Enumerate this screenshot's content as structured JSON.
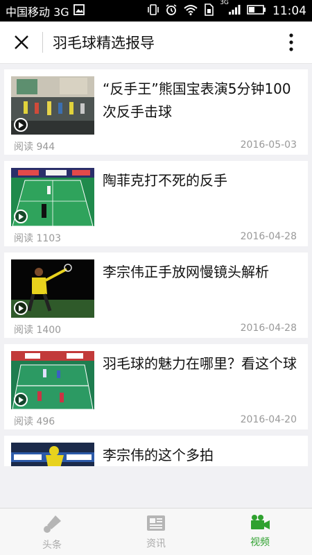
{
  "status_bar": {
    "carrier": "中国移动 3G",
    "network_small": "3G",
    "time": "11:04"
  },
  "header": {
    "title": "羽毛球精选报导",
    "close_icon": "close-icon",
    "more_icon": "more-vertical-icon"
  },
  "articles": [
    {
      "title": "“反手王”熊国宝表演5分钟100次反手击球",
      "reads": "阅读 944",
      "date": "2016-05-03"
    },
    {
      "title": "陶菲克打不死的反手",
      "reads": "阅读 1103",
      "date": "2016-04-28"
    },
    {
      "title": "李宗伟正手放网慢镜头解析",
      "reads": "阅读 1400",
      "date": "2016-04-28"
    },
    {
      "title": "羽毛球的魅力在哪里？看这个球",
      "reads": "阅读 496",
      "date": "2016-04-20"
    },
    {
      "title": "李宗伟的这个多拍",
      "reads": "",
      "date": ""
    }
  ],
  "tabs": [
    {
      "label": "头条",
      "icon": "shuttlecock-icon",
      "active": false
    },
    {
      "label": "资讯",
      "icon": "newspaper-icon",
      "active": false
    },
    {
      "label": "视频",
      "icon": "video-camera-icon",
      "active": true
    }
  ],
  "colors": {
    "accent": "#2fa12f",
    "inactive": "#aaaaaa",
    "meta_text": "#999999"
  }
}
